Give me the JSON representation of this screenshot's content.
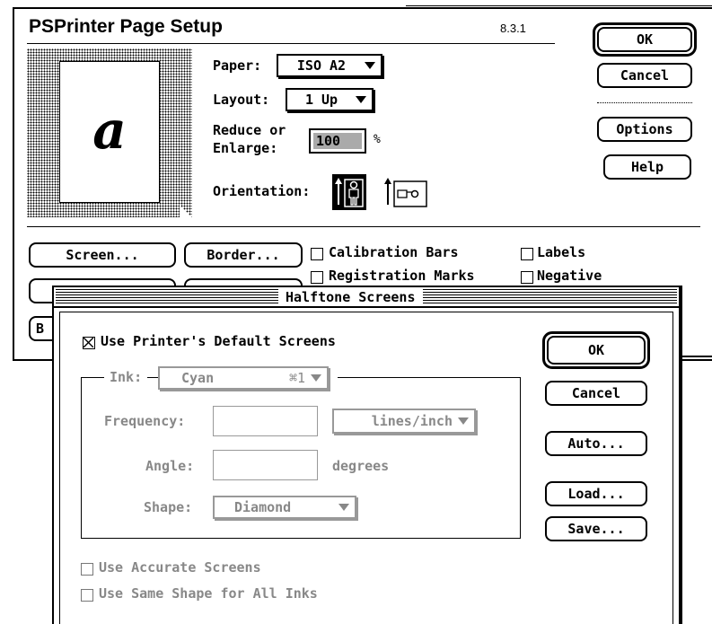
{
  "page_setup": {
    "title": "PSPrinter Page Setup",
    "version": "8.3.1",
    "preview_glyph": "a",
    "paper_label": "Paper:",
    "paper_value": "ISO A2",
    "layout_label": "Layout:",
    "layout_value": "1 Up",
    "reduce_label_1": "Reduce or",
    "reduce_label_2": "Enlarge:",
    "reduce_value": "100",
    "percent": "%",
    "orientation_label": "Orientation:",
    "ok": "OK",
    "cancel": "Cancel",
    "options": "Options",
    "help": "Help",
    "screen_button": "Screen...",
    "border_button": "Border...",
    "cb_calibration": "Calibration Bars",
    "cb_labels": "Labels",
    "cb_registration": "Registration Marks",
    "cb_negative": "Negative",
    "partial_button": "B"
  },
  "halftone": {
    "title": "Halftone Screens",
    "use_default_label": "Use Printer's Default Screens",
    "use_default_checked": true,
    "ink_label": "Ink:",
    "ink_value": "Cyan",
    "ink_shortcut": "⌘1",
    "frequency_label": "Frequency:",
    "frequency_value": "",
    "frequency_unit": "lines/inch",
    "angle_label": "Angle:",
    "angle_value": "",
    "angle_unit": "degrees",
    "shape_label": "Shape:",
    "shape_value": "Diamond",
    "accurate_label": "Use Accurate Screens",
    "same_shape_label": "Use Same Shape for All Inks",
    "ok": "OK",
    "cancel": "Cancel",
    "auto": "Auto...",
    "load": "Load...",
    "save": "Save..."
  }
}
